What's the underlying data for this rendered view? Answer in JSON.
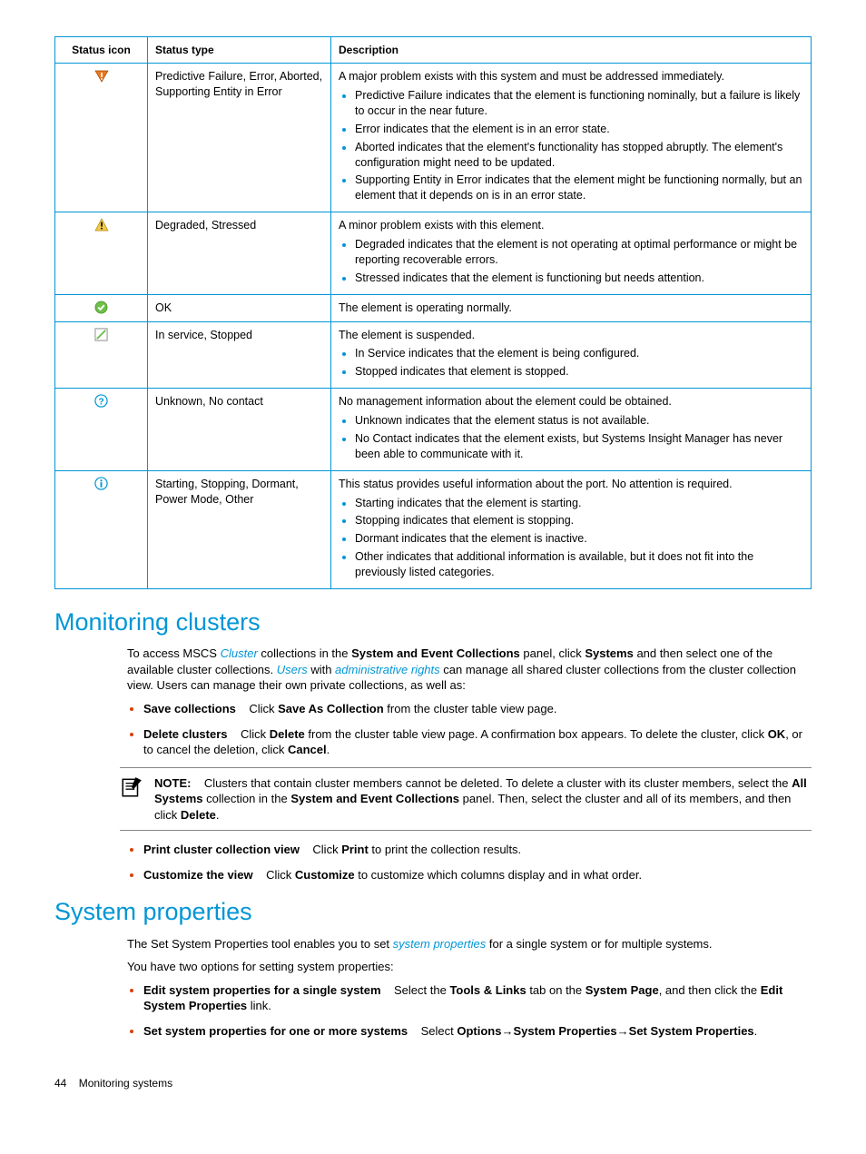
{
  "table": {
    "headers": [
      "Status icon",
      "Status type",
      "Description"
    ],
    "rows": [
      {
        "icon": "error",
        "type": "Predictive Failure, Error, Aborted, Supporting Entity in Error",
        "desc_intro": "A major problem exists with this system and must be addressed immediately.",
        "bullets": [
          "Predictive Failure indicates that the element is functioning nominally, but a failure is likely to occur in the near future.",
          "Error indicates that the element is in an error state.",
          "Aborted indicates that the element's functionality has stopped abruptly. The element's configuration might need to be updated.",
          "Supporting Entity in Error indicates that the element might be functioning normally, but an element that it depends on is in an error state."
        ]
      },
      {
        "icon": "warning",
        "type": "Degraded, Stressed",
        "desc_intro": "A minor problem exists with this element.",
        "bullets": [
          "Degraded indicates that the element is not operating at optimal performance or might be reporting recoverable errors.",
          "Stressed indicates that the element is functioning but needs attention."
        ]
      },
      {
        "icon": "ok",
        "type": "OK",
        "desc_intro": "The element is operating normally.",
        "bullets": []
      },
      {
        "icon": "suspended",
        "type": "In service, Stopped",
        "desc_intro": "The element is suspended.",
        "bullets": [
          "In Service indicates that the element is being configured.",
          "Stopped indicates that element is stopped."
        ]
      },
      {
        "icon": "unknown",
        "type": "Unknown, No contact",
        "desc_intro": "No management information about the element could be obtained.",
        "bullets": [
          "Unknown indicates that the element status is not available.",
          "No Contact indicates that the element exists, but Systems Insight Manager has never been able to communicate with it."
        ]
      },
      {
        "icon": "info",
        "type": "Starting, Stopping, Dormant, Power Mode, Other",
        "desc_intro": "This status provides useful information about the port. No attention is required.",
        "bullets": [
          "Starting indicates that the element is starting.",
          "Stopping indicates that element is stopping.",
          "Dormant indicates that the element is inactive.",
          "Other indicates that additional information is available, but it does not fit into the previously listed categories."
        ]
      }
    ]
  },
  "section1": {
    "heading": "Monitoring clusters",
    "intro_parts": {
      "p1a": "To access MSCS ",
      "p1_link1": "Cluster",
      "p1b": " collections in the ",
      "p1_bold1": "System and Event Collections",
      "p1c": " panel, click ",
      "p1_bold2": "Systems",
      "p1d": " and then select one of the available cluster collections. ",
      "p1_link2": "Users",
      "p1e": " with ",
      "p1_link3": "administrative rights",
      "p1f": " can manage all shared cluster collections from the cluster collection view. Users can manage their own private collections, as well as:"
    },
    "items": {
      "save": {
        "label": "Save collections",
        "t1": "Click ",
        "b1": "Save As Collection",
        "t2": " from the cluster table view page."
      },
      "delete": {
        "label": "Delete clusters",
        "t1": "Click ",
        "b1": "Delete",
        "t2": " from the cluster table view page. A confirmation box appears. To delete the cluster, click ",
        "b2": "OK",
        "t3": ", or to cancel the deletion, click ",
        "b3": "Cancel",
        "t4": "."
      },
      "print": {
        "label": "Print cluster collection view",
        "t1": "Click ",
        "b1": "Print",
        "t2": " to print the collection results."
      },
      "customize": {
        "label": "Customize the view",
        "t1": "Click ",
        "b1": "Customize",
        "t2": " to customize which columns display and in what order."
      }
    },
    "note": {
      "label": "NOTE:",
      "t1": "Clusters that contain cluster members cannot be deleted. To delete a cluster with its cluster members, select the ",
      "b1": "All Systems",
      "t2": " collection in the ",
      "b2": "System and Event Collections",
      "t3": " panel. Then, select the cluster and all of its members, and then click ",
      "b3": "Delete",
      "t4": "."
    }
  },
  "section2": {
    "heading": "System properties",
    "p1a": "The Set System Properties tool enables you to set ",
    "p1_link": "system properties",
    "p1b": " for a single system or for multiple systems.",
    "p2": "You have two options for setting system properties:",
    "items": {
      "edit": {
        "label": "Edit system properties for a single system",
        "t1": "Select the ",
        "b1": "Tools & Links",
        "t2": " tab on the ",
        "b2": "System Page",
        "t3": ", and then click the ",
        "b3": "Edit System Properties",
        "t4": " link."
      },
      "set": {
        "label": "Set system properties for one or more systems",
        "t1": "Select ",
        "b1": "Options",
        "arrow1": "→",
        "b2": "System Properties",
        "arrow2": "→",
        "b3": "Set System Properties",
        "t2": "."
      }
    }
  },
  "footer": {
    "page": "44",
    "title": "Monitoring systems"
  }
}
